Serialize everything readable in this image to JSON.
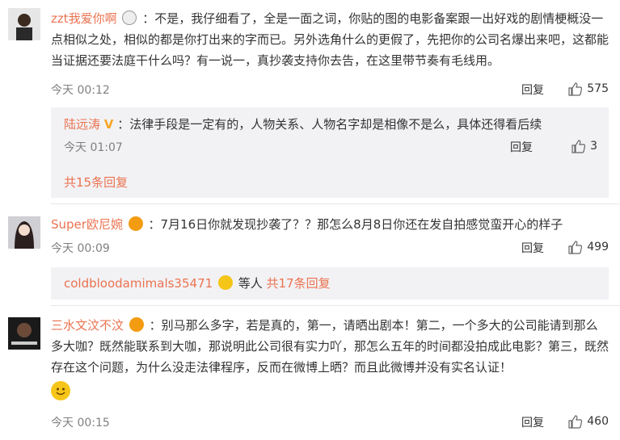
{
  "comments": [
    {
      "name": "zzt我爱你啊",
      "text": "：不是，我仔细看了，全是一面之词，你贴的图的电影备案跟一出好戏的剧情梗概没一点相似之处，相似的都是你打出来的字而已。另外选角什么的更假了，先把你的公司名爆出来吧，这都能当证据还要法庭干什么吗？有一说一，真抄袭支持你去告，在这里带节奏有毛线用。",
      "time": "今天 00:12",
      "reply_label": "回复",
      "likes": "575",
      "sub_reply": {
        "name": "陆远涛",
        "text": "：法律手段是一定有的，人物关系、人物名字却是相像不是么，具体还得看后续",
        "time": "今天 01:07",
        "reply_label": "回复",
        "likes": "3"
      },
      "more_replies": "共15条回复"
    },
    {
      "name": "Super欧尼婉",
      "text": "：7月16日你就发现抄袭了？？那怎么8月8日你还在发自拍感觉蛮开心的样子",
      "time": "今天 00:09",
      "reply_label": "回复",
      "likes": "499",
      "sub_reply": {
        "name": "coldbloodamimals35471",
        "suffix": "等人",
        "more": "共17条回复"
      }
    },
    {
      "name": "三水文汶不汶",
      "text": "：别马那么多字，若是真的，第一，请晒出剧本！第二，一个多大的公司能请到那么多大咖？既然能联系到大咖，那说明此公司很有实力吖，那怎么五年的时间都没拍成此电影？第三，既然存在这个问题，为什么没走法律程序，反而在微博上晒？而且此微博并没有实名认证！",
      "time": "今天 00:15",
      "reply_label": "回复",
      "likes": "460"
    }
  ]
}
